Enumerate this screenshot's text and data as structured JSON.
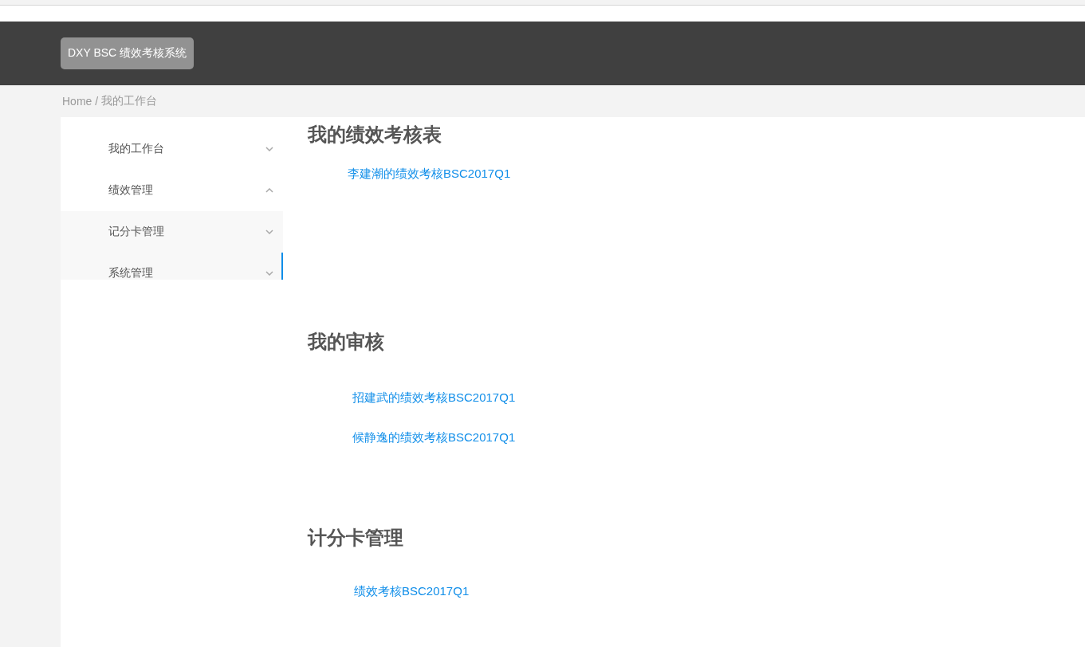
{
  "header": {
    "brand": "DXY BSC 绩效考核系统"
  },
  "breadcrumb": {
    "home": "Home",
    "separator": "/",
    "current": "我的工作台"
  },
  "sidebar": {
    "items": [
      {
        "label": "我的工作台",
        "expanded": false,
        "selected": false
      },
      {
        "label": "绩效管理",
        "expanded": true,
        "selected": false,
        "children": [
          {
            "label": "记分卡管理",
            "expanded": false,
            "selected": false
          },
          {
            "label": "系统管理",
            "expanded": false,
            "selected": true
          }
        ]
      }
    ]
  },
  "sections": [
    {
      "title": "我的绩效考核表",
      "links": [
        "李建潮的绩效考核BSC2017Q1"
      ]
    },
    {
      "title": "我的审核",
      "links": [
        "招建武的绩效考核BSC2017Q1",
        "候静逸的绩效考核BSC2017Q1"
      ]
    },
    {
      "title": "计分卡管理",
      "links": [
        "绩效考核BSC2017Q1"
      ]
    }
  ]
}
